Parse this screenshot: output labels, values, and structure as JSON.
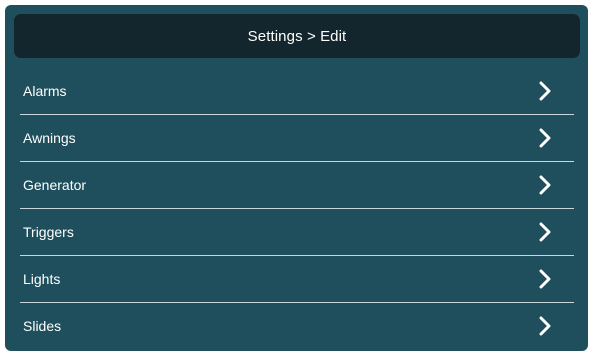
{
  "header": {
    "title": "Settings > Edit"
  },
  "menu": {
    "items": [
      {
        "label": "Alarms",
        "icon": "chevron-right-icon"
      },
      {
        "label": "Awnings",
        "icon": "chevron-right-icon"
      },
      {
        "label": "Generator",
        "icon": "chevron-right-icon"
      },
      {
        "label": "Triggers",
        "icon": "chevron-right-icon"
      },
      {
        "label": "Lights",
        "icon": "chevron-right-icon"
      },
      {
        "label": "Slides",
        "icon": "chevron-right-icon"
      }
    ]
  },
  "colors": {
    "panel_background": "#1f4f5c",
    "header_background": "#13252d",
    "text": "#ffffff",
    "divider": "#c9d6da"
  }
}
